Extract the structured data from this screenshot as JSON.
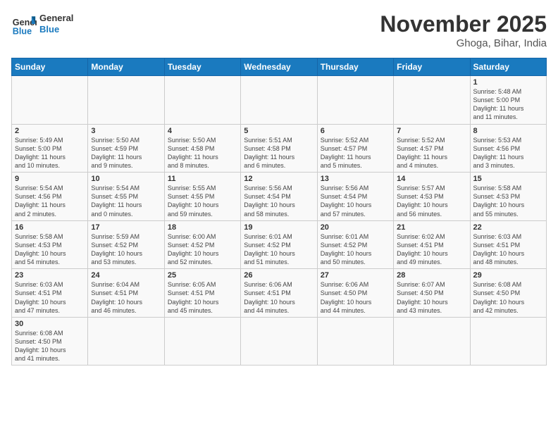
{
  "header": {
    "logo_general": "General",
    "logo_blue": "Blue",
    "month_year": "November 2025",
    "location": "Ghoga, Bihar, India"
  },
  "weekdays": [
    "Sunday",
    "Monday",
    "Tuesday",
    "Wednesday",
    "Thursday",
    "Friday",
    "Saturday"
  ],
  "days": [
    {
      "num": "",
      "info": ""
    },
    {
      "num": "",
      "info": ""
    },
    {
      "num": "",
      "info": ""
    },
    {
      "num": "",
      "info": ""
    },
    {
      "num": "",
      "info": ""
    },
    {
      "num": "",
      "info": ""
    },
    {
      "num": "1",
      "info": "Sunrise: 5:48 AM\nSunset: 5:00 PM\nDaylight: 11 hours\nand 11 minutes."
    },
    {
      "num": "2",
      "info": "Sunrise: 5:49 AM\nSunset: 5:00 PM\nDaylight: 11 hours\nand 10 minutes."
    },
    {
      "num": "3",
      "info": "Sunrise: 5:50 AM\nSunset: 4:59 PM\nDaylight: 11 hours\nand 9 minutes."
    },
    {
      "num": "4",
      "info": "Sunrise: 5:50 AM\nSunset: 4:58 PM\nDaylight: 11 hours\nand 8 minutes."
    },
    {
      "num": "5",
      "info": "Sunrise: 5:51 AM\nSunset: 4:58 PM\nDaylight: 11 hours\nand 6 minutes."
    },
    {
      "num": "6",
      "info": "Sunrise: 5:52 AM\nSunset: 4:57 PM\nDaylight: 11 hours\nand 5 minutes."
    },
    {
      "num": "7",
      "info": "Sunrise: 5:52 AM\nSunset: 4:57 PM\nDaylight: 11 hours\nand 4 minutes."
    },
    {
      "num": "8",
      "info": "Sunrise: 5:53 AM\nSunset: 4:56 PM\nDaylight: 11 hours\nand 3 minutes."
    },
    {
      "num": "9",
      "info": "Sunrise: 5:54 AM\nSunset: 4:56 PM\nDaylight: 11 hours\nand 2 minutes."
    },
    {
      "num": "10",
      "info": "Sunrise: 5:54 AM\nSunset: 4:55 PM\nDaylight: 11 hours\nand 0 minutes."
    },
    {
      "num": "11",
      "info": "Sunrise: 5:55 AM\nSunset: 4:55 PM\nDaylight: 10 hours\nand 59 minutes."
    },
    {
      "num": "12",
      "info": "Sunrise: 5:56 AM\nSunset: 4:54 PM\nDaylight: 10 hours\nand 58 minutes."
    },
    {
      "num": "13",
      "info": "Sunrise: 5:56 AM\nSunset: 4:54 PM\nDaylight: 10 hours\nand 57 minutes."
    },
    {
      "num": "14",
      "info": "Sunrise: 5:57 AM\nSunset: 4:53 PM\nDaylight: 10 hours\nand 56 minutes."
    },
    {
      "num": "15",
      "info": "Sunrise: 5:58 AM\nSunset: 4:53 PM\nDaylight: 10 hours\nand 55 minutes."
    },
    {
      "num": "16",
      "info": "Sunrise: 5:58 AM\nSunset: 4:53 PM\nDaylight: 10 hours\nand 54 minutes."
    },
    {
      "num": "17",
      "info": "Sunrise: 5:59 AM\nSunset: 4:52 PM\nDaylight: 10 hours\nand 53 minutes."
    },
    {
      "num": "18",
      "info": "Sunrise: 6:00 AM\nSunset: 4:52 PM\nDaylight: 10 hours\nand 52 minutes."
    },
    {
      "num": "19",
      "info": "Sunrise: 6:01 AM\nSunset: 4:52 PM\nDaylight: 10 hours\nand 51 minutes."
    },
    {
      "num": "20",
      "info": "Sunrise: 6:01 AM\nSunset: 4:52 PM\nDaylight: 10 hours\nand 50 minutes."
    },
    {
      "num": "21",
      "info": "Sunrise: 6:02 AM\nSunset: 4:51 PM\nDaylight: 10 hours\nand 49 minutes."
    },
    {
      "num": "22",
      "info": "Sunrise: 6:03 AM\nSunset: 4:51 PM\nDaylight: 10 hours\nand 48 minutes."
    },
    {
      "num": "23",
      "info": "Sunrise: 6:03 AM\nSunset: 4:51 PM\nDaylight: 10 hours\nand 47 minutes."
    },
    {
      "num": "24",
      "info": "Sunrise: 6:04 AM\nSunset: 4:51 PM\nDaylight: 10 hours\nand 46 minutes."
    },
    {
      "num": "25",
      "info": "Sunrise: 6:05 AM\nSunset: 4:51 PM\nDaylight: 10 hours\nand 45 minutes."
    },
    {
      "num": "26",
      "info": "Sunrise: 6:06 AM\nSunset: 4:51 PM\nDaylight: 10 hours\nand 44 minutes."
    },
    {
      "num": "27",
      "info": "Sunrise: 6:06 AM\nSunset: 4:50 PM\nDaylight: 10 hours\nand 44 minutes."
    },
    {
      "num": "28",
      "info": "Sunrise: 6:07 AM\nSunset: 4:50 PM\nDaylight: 10 hours\nand 43 minutes."
    },
    {
      "num": "29",
      "info": "Sunrise: 6:08 AM\nSunset: 4:50 PM\nDaylight: 10 hours\nand 42 minutes."
    },
    {
      "num": "30",
      "info": "Sunrise: 6:08 AM\nSunset: 4:50 PM\nDaylight: 10 hours\nand 41 minutes."
    },
    {
      "num": "",
      "info": ""
    },
    {
      "num": "",
      "info": ""
    },
    {
      "num": "",
      "info": ""
    },
    {
      "num": "",
      "info": ""
    },
    {
      "num": "",
      "info": ""
    },
    {
      "num": "",
      "info": ""
    }
  ]
}
